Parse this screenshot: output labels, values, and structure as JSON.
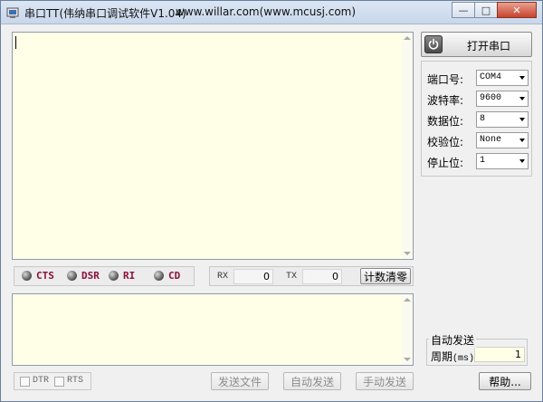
{
  "window": {
    "title": "串口TT(伟纳串口调试软件V1.04)",
    "site": "www.willar.com(www.mcusj.com)",
    "min_label": "—",
    "max_label": "□",
    "close_label": "✕"
  },
  "status": {
    "cts": "CTS",
    "dsr": "DSR",
    "ri": "RI",
    "cd": "CD"
  },
  "counters": {
    "rx_label": "RX",
    "rx_value": "0",
    "tx_label": "TX",
    "tx_value": "0",
    "reset_label": "计数清零"
  },
  "controls": {
    "dtr": "DTR",
    "rts": "RTS",
    "send_file": "发送文件",
    "auto_send": "自动发送",
    "manual_send": "手动发送",
    "help": "帮助..."
  },
  "port": {
    "open_label": "打开串口",
    "settings": [
      {
        "label": "端口号:",
        "value": "COM4"
      },
      {
        "label": "波特率:",
        "value": "9600"
      },
      {
        "label": "数据位:",
        "value": "8"
      },
      {
        "label": "校验位:",
        "value": "None"
      },
      {
        "label": "停止位:",
        "value": "1"
      }
    ]
  },
  "auto": {
    "title": "自动发送",
    "period_label": "周期",
    "period_unit": "(ms)",
    "period_value": "1"
  },
  "colors": {
    "text_area_bg": "#ffffe8",
    "led_label": "#8b1038"
  }
}
